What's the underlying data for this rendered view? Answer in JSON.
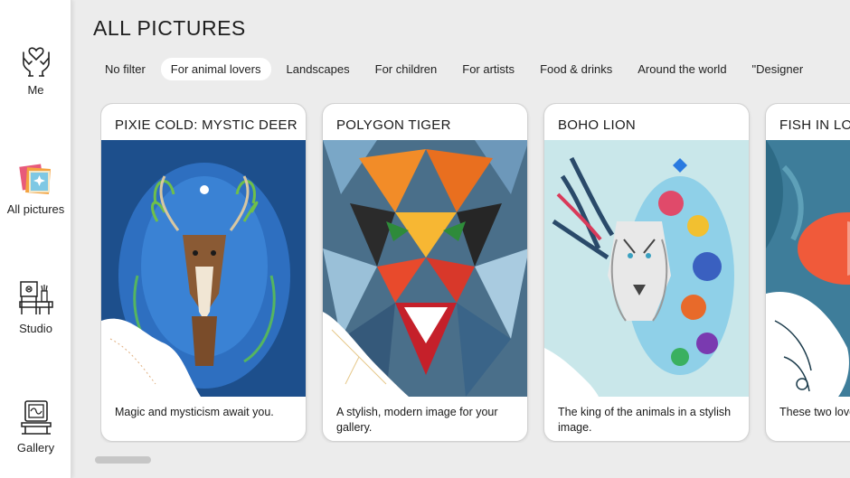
{
  "sidebar": {
    "items": [
      {
        "label": "Me",
        "icon": "hands-heart-icon"
      },
      {
        "label": "All pictures",
        "icon": "pictures-stack-icon"
      },
      {
        "label": "Studio",
        "icon": "easel-desk-icon"
      },
      {
        "label": "Gallery",
        "icon": "framed-art-icon"
      }
    ]
  },
  "main": {
    "title": "ALL PICTURES",
    "filters": [
      "No filter",
      "For animal lovers",
      "Landscapes",
      "For children",
      "For artists",
      "Food & drinks",
      "Around the world",
      "\"Designer"
    ],
    "active_filter": "For animal lovers",
    "cards": [
      {
        "title": "PIXIE COLD: MYSTIC DEER",
        "description": "Magic and mysticism await you."
      },
      {
        "title": "POLYGON TIGER",
        "description": "A stylish, modern image for your gallery."
      },
      {
        "title": "BOHO LION",
        "description": "The king of the animals in a stylish image."
      },
      {
        "title": "FISH IN LOVE",
        "description": "These two love"
      }
    ]
  },
  "colors": {
    "background": "#ececec",
    "sidebar": "#ffffff",
    "card": "#ffffff",
    "chip_active": "#ffffff",
    "text": "#222222"
  }
}
